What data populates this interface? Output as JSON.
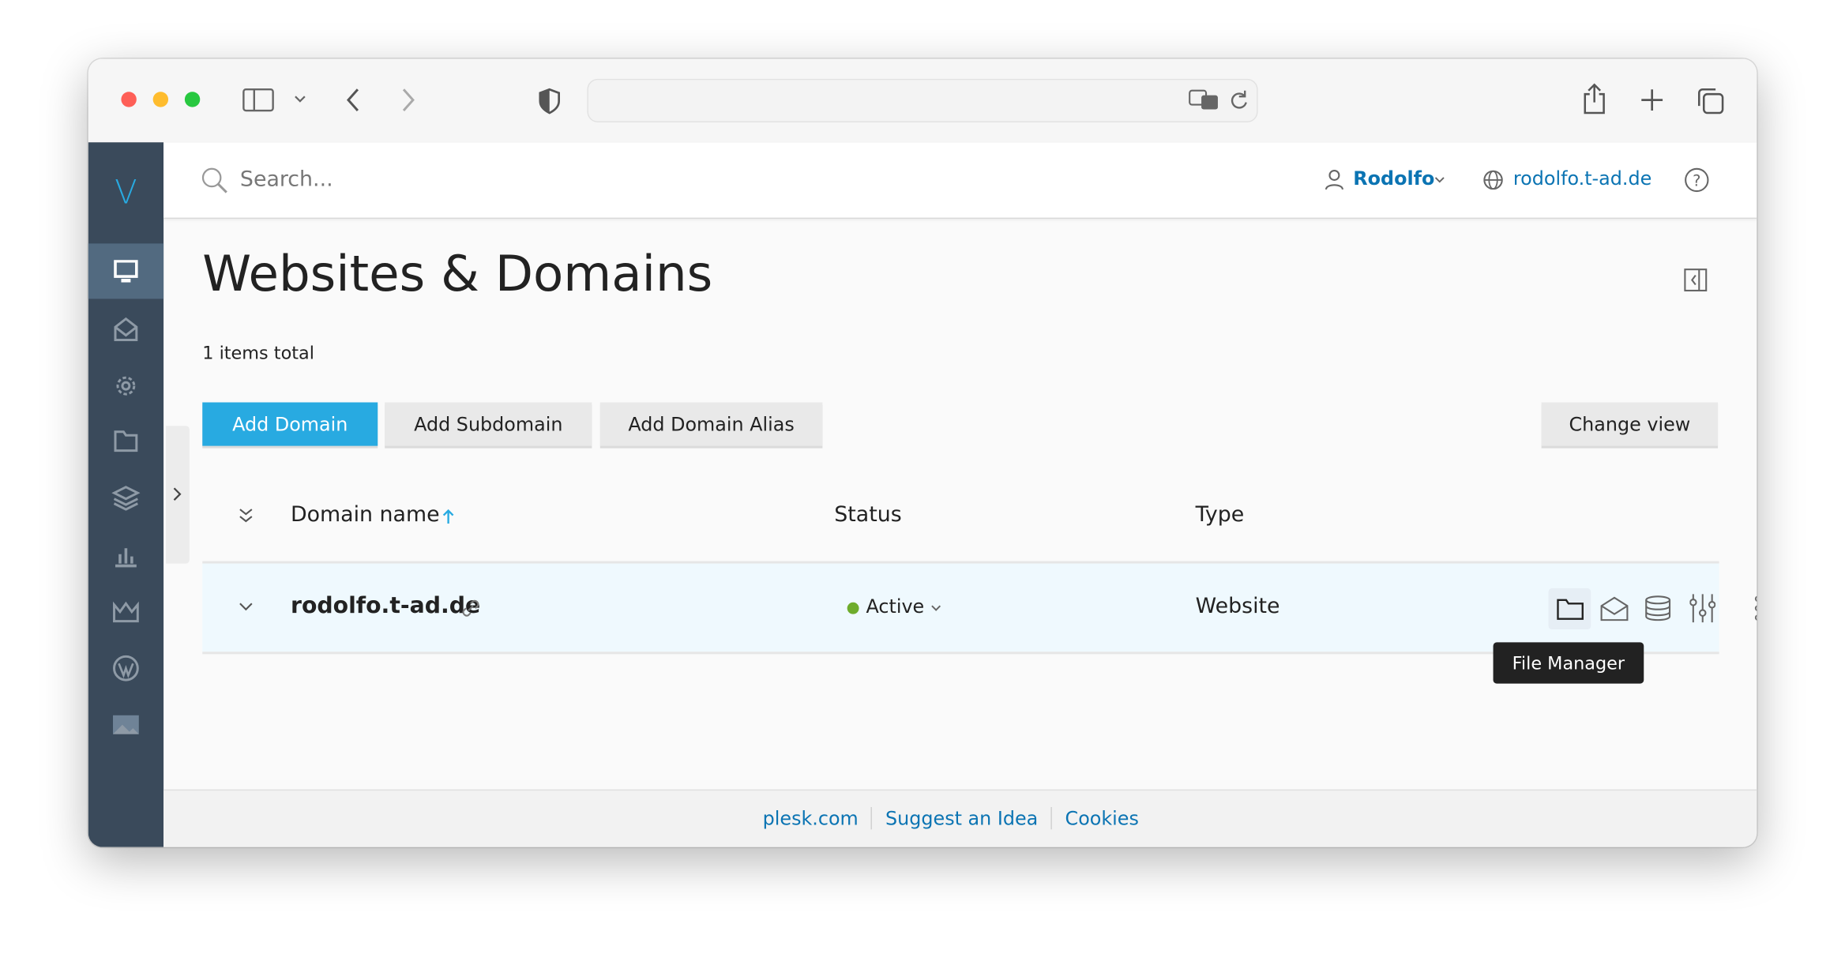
{
  "browser": {
    "icons": [
      "sidebar-icon",
      "chevron-down-icon",
      "back-icon",
      "forward-icon",
      "shield-icon",
      "translate-icon",
      "reload-icon",
      "share-icon",
      "plus-icon",
      "tabs-icon"
    ]
  },
  "sidebar": {
    "logo": "V",
    "items": [
      {
        "icon": "monitor-icon",
        "active": true
      },
      {
        "icon": "mail-icon"
      },
      {
        "icon": "gear-icon"
      },
      {
        "icon": "folder-icon"
      },
      {
        "icon": "layers-icon"
      },
      {
        "icon": "chart-icon"
      },
      {
        "icon": "crown-icon"
      },
      {
        "icon": "wordpress-icon"
      },
      {
        "icon": "image-icon"
      }
    ]
  },
  "header": {
    "search_placeholder": "Search...",
    "user": "Rodolfo",
    "domain": "rodolfo.t-ad.de"
  },
  "page": {
    "title": "Websites & Domains",
    "count": "1 items total"
  },
  "toolbar": {
    "add_domain": "Add Domain",
    "add_subdomain": "Add Subdomain",
    "add_alias": "Add Domain Alias",
    "change_view": "Change view"
  },
  "table": {
    "columns": [
      "Domain name",
      "Status",
      "Type"
    ],
    "sort": "ascending",
    "rows": [
      {
        "domain": "rodolfo.t-ad.de",
        "status": "Active",
        "type": "Website"
      }
    ]
  },
  "tooltip": "File Manager",
  "footer": {
    "links": [
      "plesk.com",
      "Suggest an Idea",
      "Cookies"
    ]
  },
  "colors": {
    "accent": "#28aae1",
    "link": "#0b74b3",
    "sidebar": "#3a4a5b",
    "active_status": "#6eac2c",
    "row_highlight": "#eff9fe"
  }
}
